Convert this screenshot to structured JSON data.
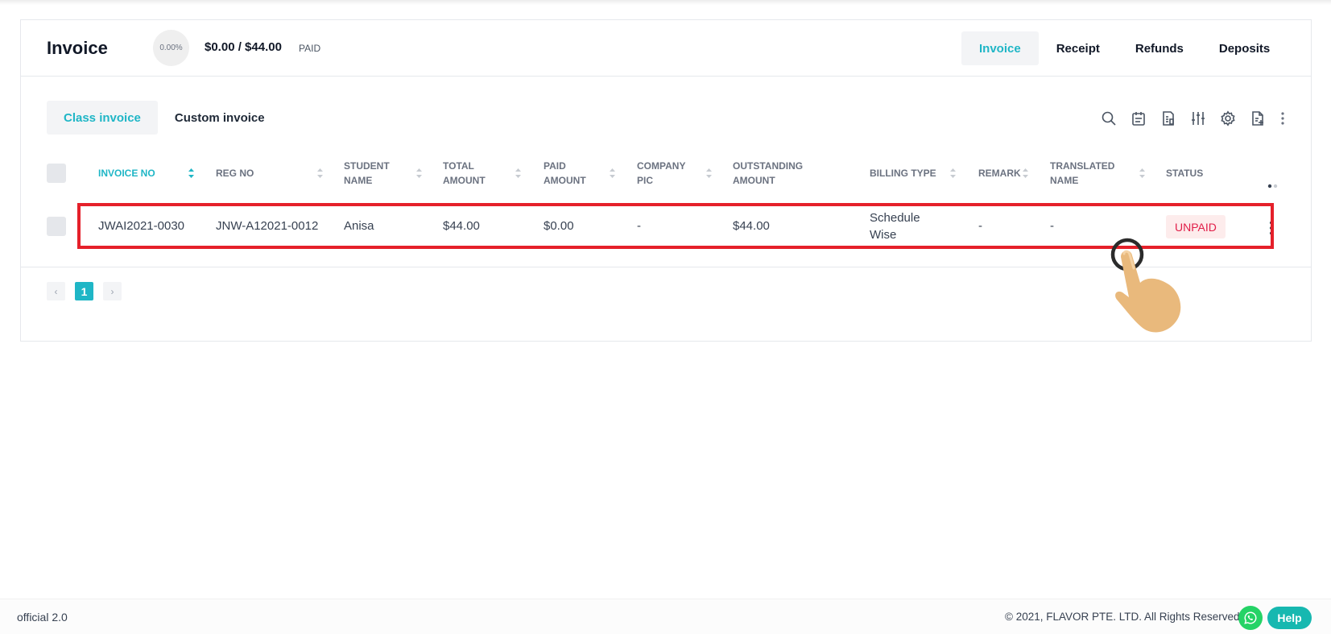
{
  "header": {
    "title": "Invoice",
    "percent": "0.00%",
    "paid_summary": "$0.00 / $44.00",
    "paid_label": "PAID",
    "tabs": [
      {
        "label": "Invoice",
        "active": true
      },
      {
        "label": "Receipt",
        "active": false
      },
      {
        "label": "Refunds",
        "active": false
      },
      {
        "label": "Deposits",
        "active": false
      }
    ]
  },
  "subtabs": [
    {
      "label": "Class invoice",
      "active": true
    },
    {
      "label": "Custom invoice",
      "active": false
    }
  ],
  "toolbar": {
    "icons": [
      "search-icon",
      "calendar-icon",
      "report-icon",
      "filter-sliders-icon",
      "gear-icon",
      "export-document-icon",
      "more-vertical-icon"
    ]
  },
  "table": {
    "columns": [
      {
        "label": "INVOICE NO",
        "sortable": true,
        "active": true
      },
      {
        "label": "REG NO",
        "sortable": true
      },
      {
        "label": "STUDENT NAME",
        "sortable": true
      },
      {
        "label": "TOTAL AMOUNT",
        "sortable": true
      },
      {
        "label": "PAID AMOUNT",
        "sortable": true
      },
      {
        "label": "COMPANY PIC",
        "sortable": true
      },
      {
        "label": "OUTSTANDING AMOUNT",
        "sortable": false
      },
      {
        "label": "BILLING TYPE",
        "sortable": true
      },
      {
        "label": "REMARK",
        "sortable": true
      },
      {
        "label": "TRANSLATED NAME",
        "sortable": true
      },
      {
        "label": "STATUS",
        "sortable": false
      }
    ],
    "rows": [
      {
        "invoice_no": "JWAI2021-0030",
        "reg_no": "JNW-A12021-0012",
        "student_name": "Anisa",
        "total_amount": "$44.00",
        "paid_amount": "$0.00",
        "company_pic": "-",
        "outstanding_amount": "$44.00",
        "billing_type": "Schedule Wise",
        "remark": "-",
        "translated_name": "-",
        "status": "UNPAID"
      }
    ]
  },
  "pagination": {
    "prev": "‹",
    "current": "1",
    "next": "›"
  },
  "footer": {
    "version": "official 2.0",
    "copyright": "© 2021, FLAVOR PTE. LTD. All Rights Reserved.",
    "help_label": "Help"
  },
  "colors": {
    "accent": "#1fb6c6",
    "unpaid": "#e11d48",
    "highlight": "#e5202a",
    "whatsapp": "#25d366"
  }
}
